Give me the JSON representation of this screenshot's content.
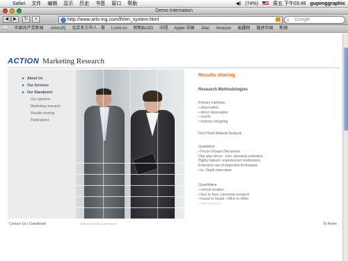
{
  "menubar": {
    "apple": "",
    "items": [
      "Safari",
      "文件",
      "编辑",
      "显示",
      "历史",
      "书签",
      "窗口",
      "帮助"
    ],
    "battery": "(74%)",
    "clock": "周五 下午03:49",
    "user": "gupenggraphic"
  },
  "window": {
    "title": "Demo Internation"
  },
  "toolbar": {
    "url": "http://www.arts-ing.com/lh/en_system.html",
    "search_placeholder": "Google"
  },
  "bookmarks": [
    "中国共产党新闻",
    ".om/csf/)",
    "北京东方华人 - 首",
    "t.com.cn",
    "明明BLOG",
    "中视",
    "Apple 中国",
    ".Mac",
    "Amazon",
    "易趣网",
    "搜虎中国",
    "新闻"
  ],
  "logo": {
    "brand": "ACTION",
    "tagline": "Marketing Research"
  },
  "nav": {
    "items": [
      {
        "label": "About Us",
        "kind": "main"
      },
      {
        "label": "Our Services",
        "kind": "main"
      },
      {
        "label": "Our Standpoint",
        "kind": "main"
      },
      {
        "label": "Our opinions",
        "kind": "sub"
      },
      {
        "label": "Marketing research",
        "kind": "sub"
      },
      {
        "label": "Results sharing",
        "kind": "sub"
      },
      {
        "label": "Publications",
        "kind": "sub"
      }
    ]
  },
  "content": {
    "heading": "Results sharing",
    "subhead": "Research Methodologies",
    "primary_title": "Primary methods:",
    "primary": [
      "• observation",
      "• direct observation",
      "• counts",
      "• mystery shopping"
    ],
    "first_hand": "First-Hand Material Analysis",
    "qualitative_title": "Qualitative",
    "qualitative": [
      "• Focus Groups Discussion",
      "One way mirror - mini, standard extended.",
      "Highly trained / experienced moderators.",
      "Extensive use of projective techniques",
      "• In- Depth Interviews"
    ],
    "quantitative_title": "Quantitative",
    "quantitative": [
      "• central location",
      "• face to face / personal research",
      "• house to house / office to office"
    ],
    "faded": "• tele research"
  },
  "footer": {
    "contact": "Contact Us",
    "separator": "|",
    "guestbook": "Guestbook",
    "copyright": "2006 © ACTION COPYRIGHT",
    "to_home": "To Home"
  },
  "colors": {
    "accent": "#f26a1b",
    "brand": "#1d3f8a"
  }
}
